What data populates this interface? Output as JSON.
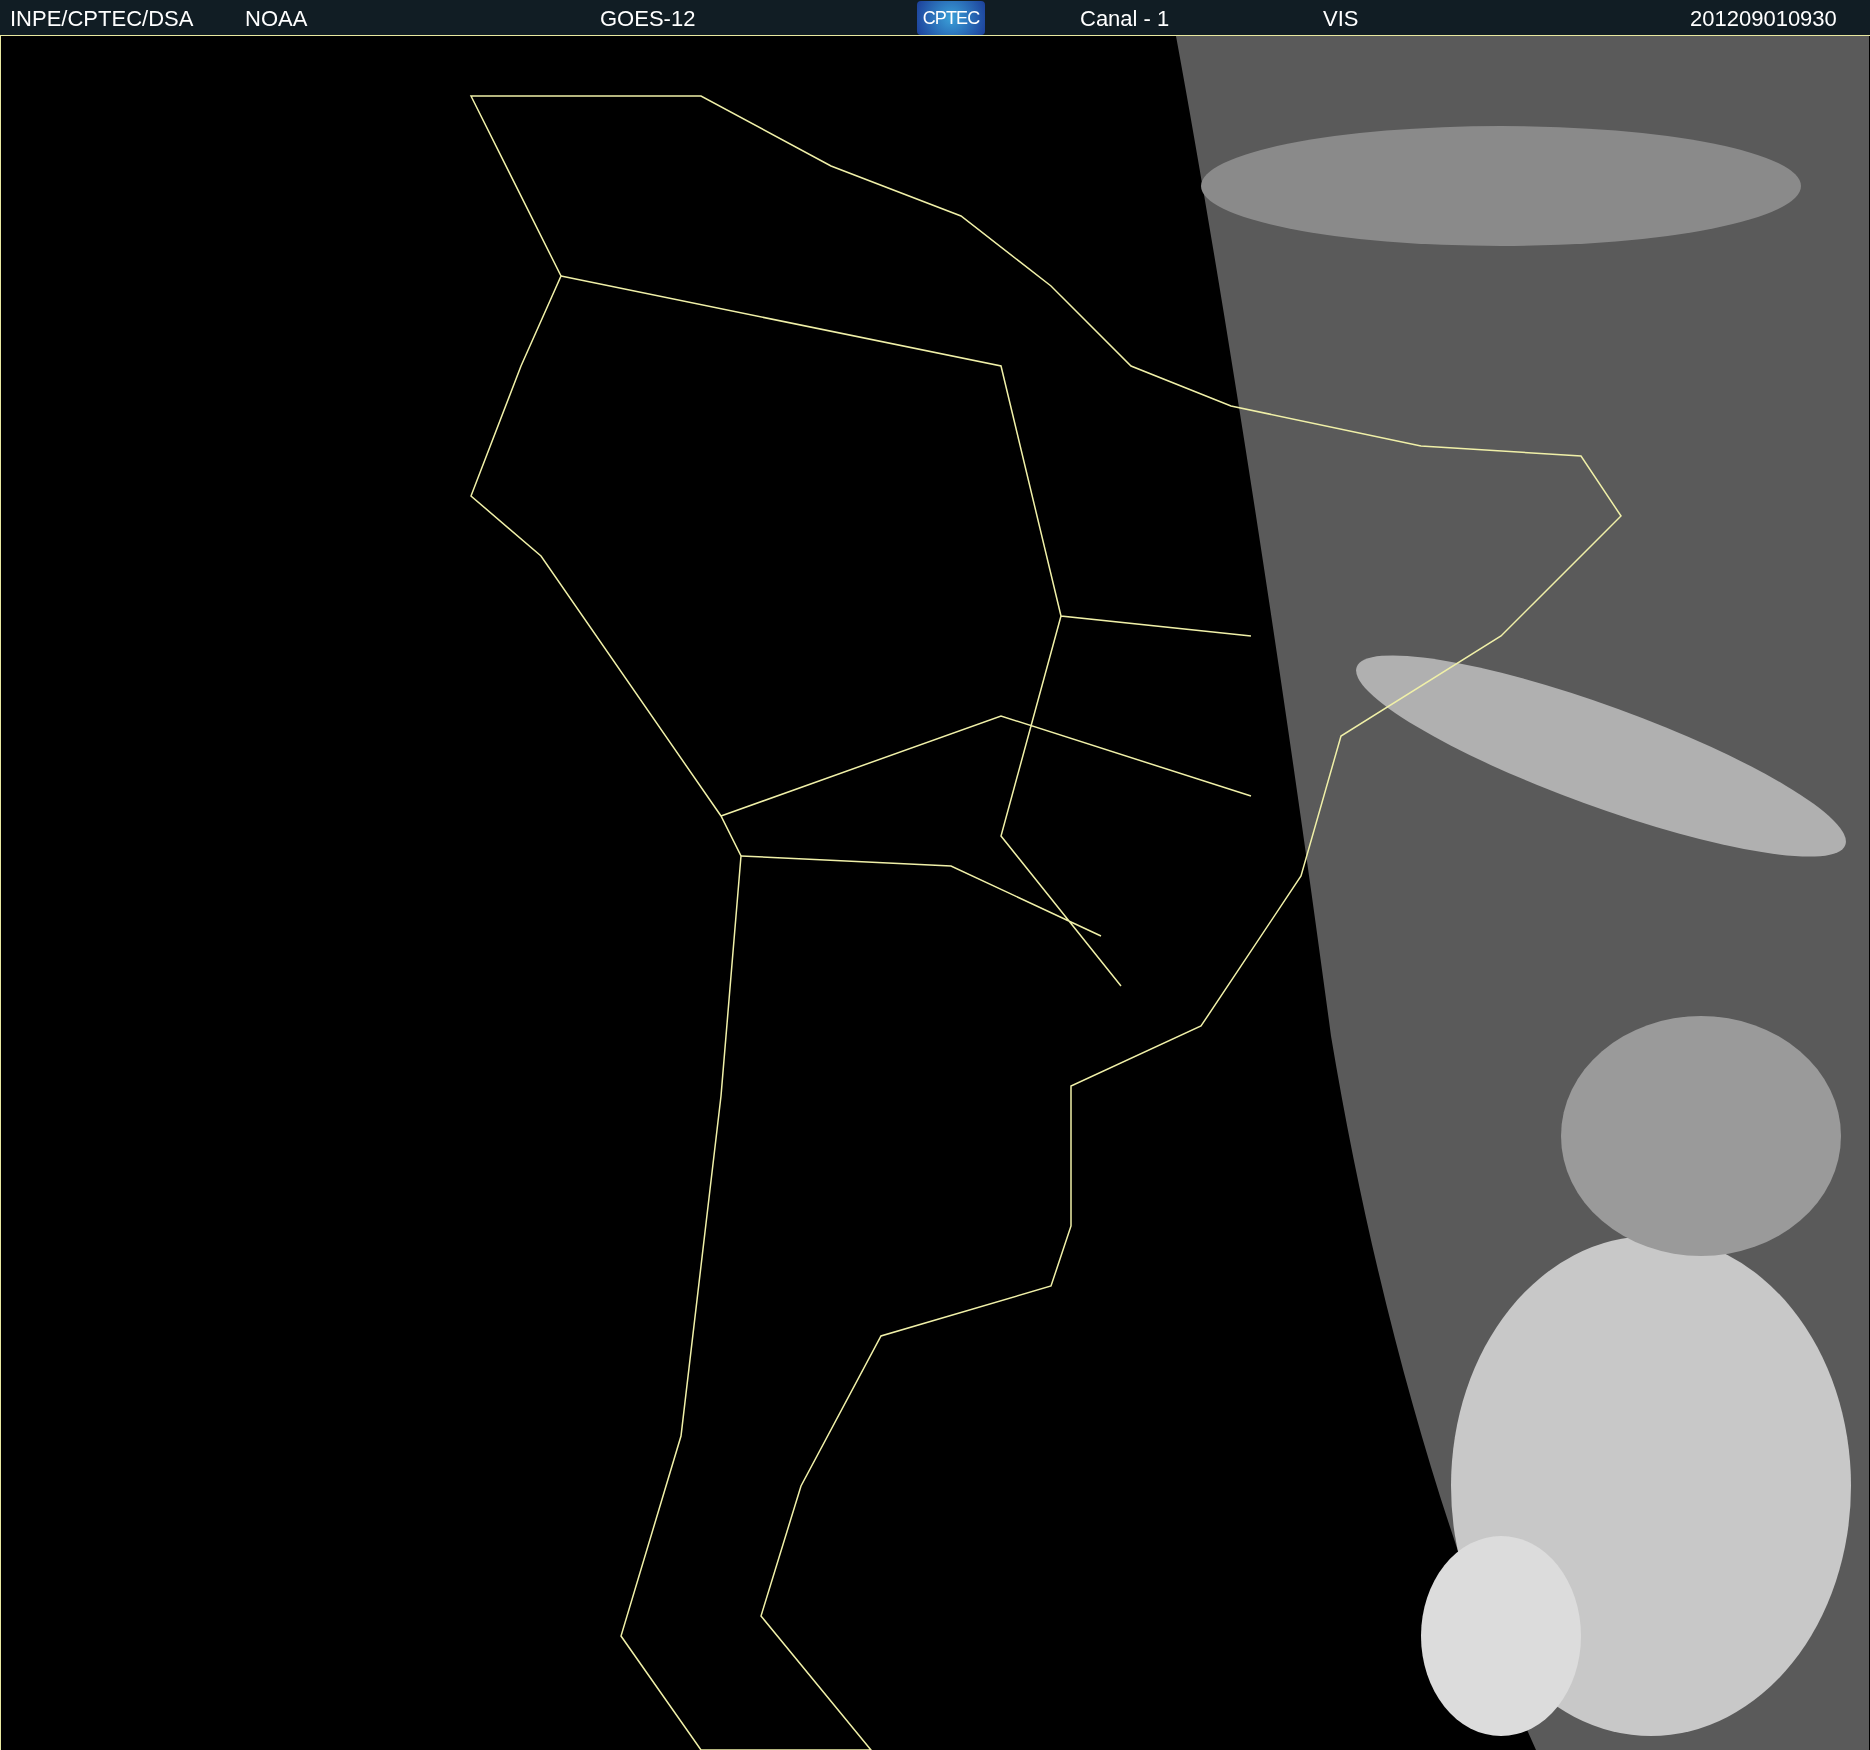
{
  "header": {
    "items": [
      {
        "kind": "text",
        "label": "INPE/CPTEC/DSA"
      },
      {
        "kind": "text",
        "label": "NOAA"
      },
      {
        "kind": "text",
        "label": "GOES-12"
      },
      {
        "kind": "logo",
        "label": "CPTEC"
      },
      {
        "kind": "text",
        "label": "Canal - 1"
      },
      {
        "kind": "text",
        "label": "VIS"
      },
      {
        "kind": "text",
        "label": "201209010930"
      }
    ]
  }
}
